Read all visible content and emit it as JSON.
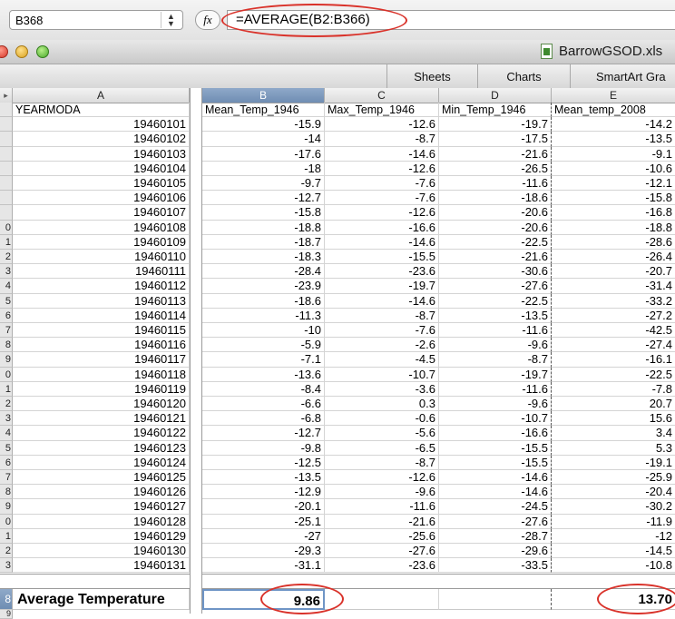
{
  "formula_bar": {
    "cell_reference": "B368",
    "fx_label": "fx",
    "formula": "=AVERAGE(B2:B366)"
  },
  "title_bar": {
    "file_name": "BarrowGSOD.xls"
  },
  "ribbon": {
    "tabs": [
      "Sheets",
      "Charts",
      "SmartArt Gra"
    ]
  },
  "columns": {
    "letters": [
      "A",
      "B",
      "C",
      "D",
      "E"
    ],
    "select_all_glyph": "▸"
  },
  "table": {
    "headers": [
      "YEARMODA",
      "Mean_Temp_1946",
      "Max_Temp_1946",
      "Min_Temp_1946",
      "Mean_temp_2008"
    ],
    "row_labels": [
      "",
      "",
      "",
      "",
      "",
      "",
      "",
      "",
      "0",
      "1",
      "2",
      "3",
      "4",
      "5",
      "6",
      "7",
      "8",
      "9",
      "0",
      "1",
      "2",
      "3",
      "4",
      "5",
      "6",
      "7",
      "8",
      "9",
      "0",
      "1",
      "2",
      "3"
    ],
    "rows": [
      [
        "19460101",
        "-15.9",
        "-12.6",
        "-19.7",
        "-14.2"
      ],
      [
        "19460102",
        "-14",
        "-8.7",
        "-17.5",
        "-13.5"
      ],
      [
        "19460103",
        "-17.6",
        "-14.6",
        "-21.6",
        "-9.1"
      ],
      [
        "19460104",
        "-18",
        "-12.6",
        "-26.5",
        "-10.6"
      ],
      [
        "19460105",
        "-9.7",
        "-7.6",
        "-11.6",
        "-12.1"
      ],
      [
        "19460106",
        "-12.7",
        "-7.6",
        "-18.6",
        "-15.8"
      ],
      [
        "19460107",
        "-15.8",
        "-12.6",
        "-20.6",
        "-16.8"
      ],
      [
        "19460108",
        "-18.8",
        "-16.6",
        "-20.6",
        "-18.8"
      ],
      [
        "19460109",
        "-18.7",
        "-14.6",
        "-22.5",
        "-28.6"
      ],
      [
        "19460110",
        "-18.3",
        "-15.5",
        "-21.6",
        "-26.4"
      ],
      [
        "19460111",
        "-28.4",
        "-23.6",
        "-30.6",
        "-20.7"
      ],
      [
        "19460112",
        "-23.9",
        "-19.7",
        "-27.6",
        "-31.4"
      ],
      [
        "19460113",
        "-18.6",
        "-14.6",
        "-22.5",
        "-33.2"
      ],
      [
        "19460114",
        "-11.3",
        "-8.7",
        "-13.5",
        "-27.2"
      ],
      [
        "19460115",
        "-10",
        "-7.6",
        "-11.6",
        "-42.5"
      ],
      [
        "19460116",
        "-5.9",
        "-2.6",
        "-9.6",
        "-27.4"
      ],
      [
        "19460117",
        "-7.1",
        "-4.5",
        "-8.7",
        "-16.1"
      ],
      [
        "19460118",
        "-13.6",
        "-10.7",
        "-19.7",
        "-22.5"
      ],
      [
        "19460119",
        "-8.4",
        "-3.6",
        "-11.6",
        "-7.8"
      ],
      [
        "19460120",
        "-6.6",
        "0.3",
        "-9.6",
        "20.7"
      ],
      [
        "19460121",
        "-6.8",
        "-0.6",
        "-10.7",
        "15.6"
      ],
      [
        "19460122",
        "-12.7",
        "-5.6",
        "-16.6",
        "3.4"
      ],
      [
        "19460123",
        "-9.8",
        "-6.5",
        "-15.5",
        "5.3"
      ],
      [
        "19460124",
        "-12.5",
        "-8.7",
        "-15.5",
        "-19.1"
      ],
      [
        "19460125",
        "-13.5",
        "-12.6",
        "-14.6",
        "-25.9"
      ],
      [
        "19460126",
        "-12.9",
        "-9.6",
        "-14.6",
        "-20.4"
      ],
      [
        "19460127",
        "-20.1",
        "-11.6",
        "-24.5",
        "-30.2"
      ],
      [
        "19460128",
        "-25.1",
        "-21.6",
        "-27.6",
        "-11.9"
      ],
      [
        "19460129",
        "-27",
        "-25.6",
        "-28.7",
        "-12"
      ],
      [
        "19460130",
        "-29.3",
        "-27.6",
        "-29.6",
        "-14.5"
      ],
      [
        "19460131",
        "-31.1",
        "-23.6",
        "-33.5",
        "-10.8"
      ]
    ]
  },
  "summary_row": {
    "row_label": "8",
    "label": "Average Temperature",
    "mean_1946": "9.86",
    "mean_2008": "13.70",
    "next_row_label": "9"
  },
  "colors": {
    "annotation_red": "#d9322a",
    "selection_blue": "#6f95c6",
    "header_selected": "#7a97bd"
  }
}
